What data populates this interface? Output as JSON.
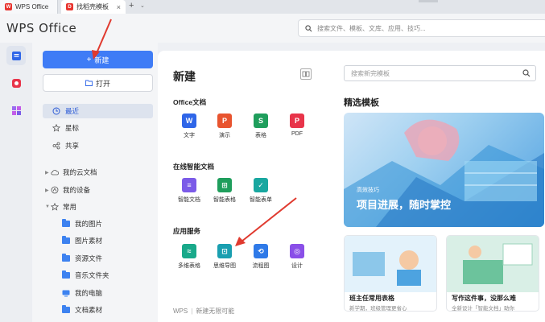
{
  "tabs": [
    {
      "label": "WPS Office",
      "icon": "wps-logo-icon"
    },
    {
      "label": "找稻壳模板",
      "icon": "docer-icon"
    }
  ],
  "header": {
    "logo": "WPS Office",
    "search_placeholder": "搜索文件、模板、文库、应用、技巧..."
  },
  "sidebar": {
    "new_label": "新建",
    "open_label": "打开",
    "nav": [
      {
        "label": "最近",
        "icon": "clock-icon"
      },
      {
        "label": "星标",
        "icon": "star-icon"
      },
      {
        "label": "共享",
        "icon": "share-icon"
      }
    ],
    "tree": [
      {
        "label": "我的云文档",
        "icon": "cloud-icon"
      },
      {
        "label": "我的设备",
        "icon": "device-icon"
      },
      {
        "label": "常用",
        "icon": "star-icon"
      }
    ],
    "common_items": [
      {
        "label": "我的图片",
        "icon": "folder-icon"
      },
      {
        "label": "图片素材",
        "icon": "folder-icon"
      },
      {
        "label": "资源文件",
        "icon": "folder-icon"
      },
      {
        "label": "音乐文件夹",
        "icon": "folder-icon"
      },
      {
        "label": "我的电脑",
        "icon": "computer-icon"
      },
      {
        "label": "文档素材",
        "icon": "folder-icon"
      }
    ]
  },
  "main": {
    "title": "新建",
    "sections": [
      {
        "title": "Office文档",
        "apps": [
          {
            "label": "文字",
            "glyph": "W",
            "color": "#2f66e8"
          },
          {
            "label": "演示",
            "glyph": "P",
            "color": "#e8542f"
          },
          {
            "label": "表格",
            "glyph": "S",
            "color": "#1f9e5c"
          },
          {
            "label": "PDF",
            "glyph": "P",
            "color": "#e8344a"
          }
        ]
      },
      {
        "title": "在线智能文档",
        "apps": [
          {
            "label": "智能文档",
            "glyph": "≡",
            "color": "#7b5be8"
          },
          {
            "label": "智能表格",
            "glyph": "⊞",
            "color": "#1f9e5c"
          },
          {
            "label": "智能表单",
            "glyph": "✓",
            "color": "#19a7a0"
          }
        ]
      },
      {
        "title": "应用服务",
        "apps": [
          {
            "label": "多维表格",
            "glyph": "≈",
            "color": "#19a98a"
          },
          {
            "label": "思维导图",
            "glyph": "⊡",
            "color": "#1a9fb0"
          },
          {
            "label": "流程图",
            "glyph": "⟲",
            "color": "#2f7ae8"
          },
          {
            "label": "设计",
            "glyph": "◎",
            "color": "#8a4fe8"
          }
        ]
      }
    ],
    "footer_brand": "WPS",
    "footer_text": "新建无限可能"
  },
  "templates": {
    "search_placeholder": "搜索新完模板",
    "title": "精选模板",
    "hero_small": "高效技巧",
    "hero_big": "项目进展，随时掌控",
    "cards": [
      {
        "title": "班主任常用表格",
        "subtitle": "新学期，班级管理更省心"
      },
      {
        "title": "写作这件事，没那么难",
        "subtitle": "全新设计「智能文档」助你"
      }
    ]
  },
  "colors": {
    "accent": "#3f7cf6",
    "annotation": "#e03a2f"
  }
}
